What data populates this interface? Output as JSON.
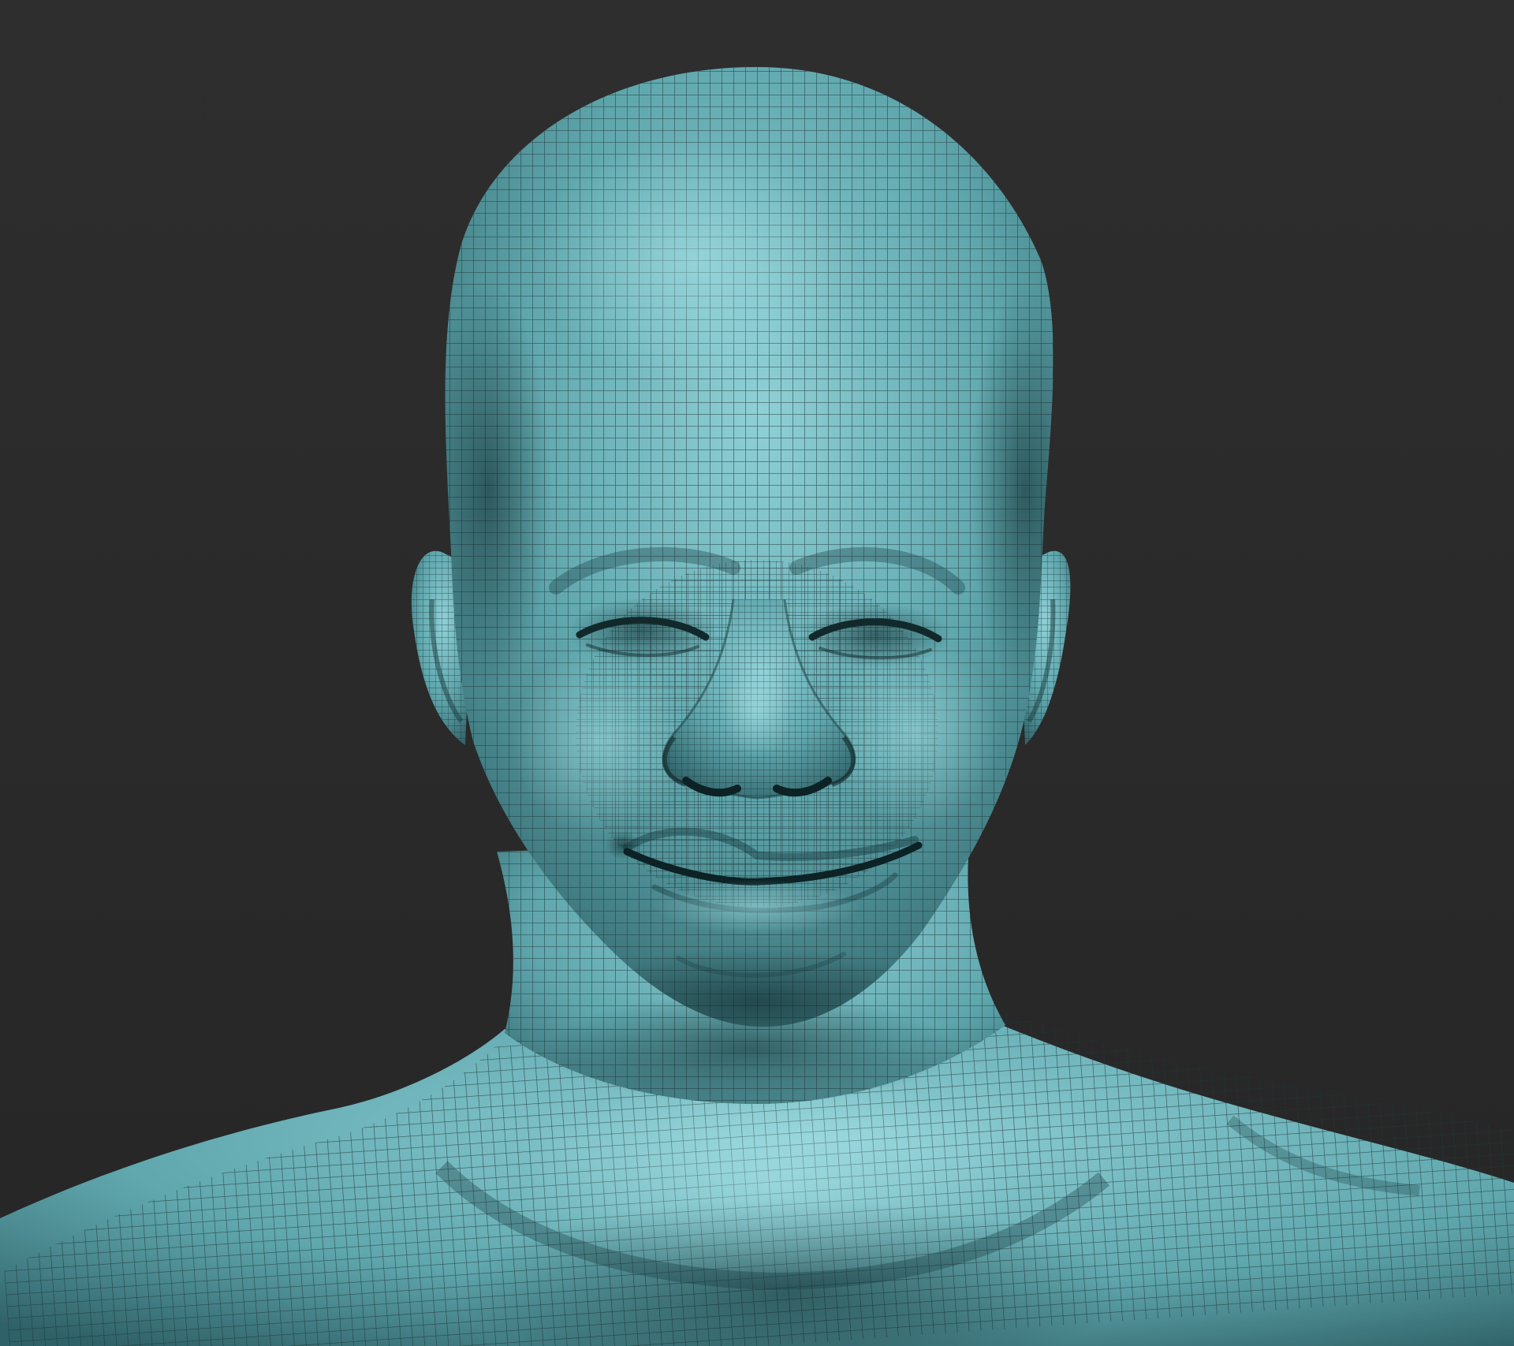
{
  "scene": {
    "background_color": "#2e2e2e",
    "mesh_base_color": "#5fa7ad",
    "mesh_highlight_color": "#8fd0d6",
    "mesh_shadow_color": "#2f6268",
    "wireframe_color": "#1e3538",
    "subject": "wireframe-head-and-shoulders-mesh"
  }
}
